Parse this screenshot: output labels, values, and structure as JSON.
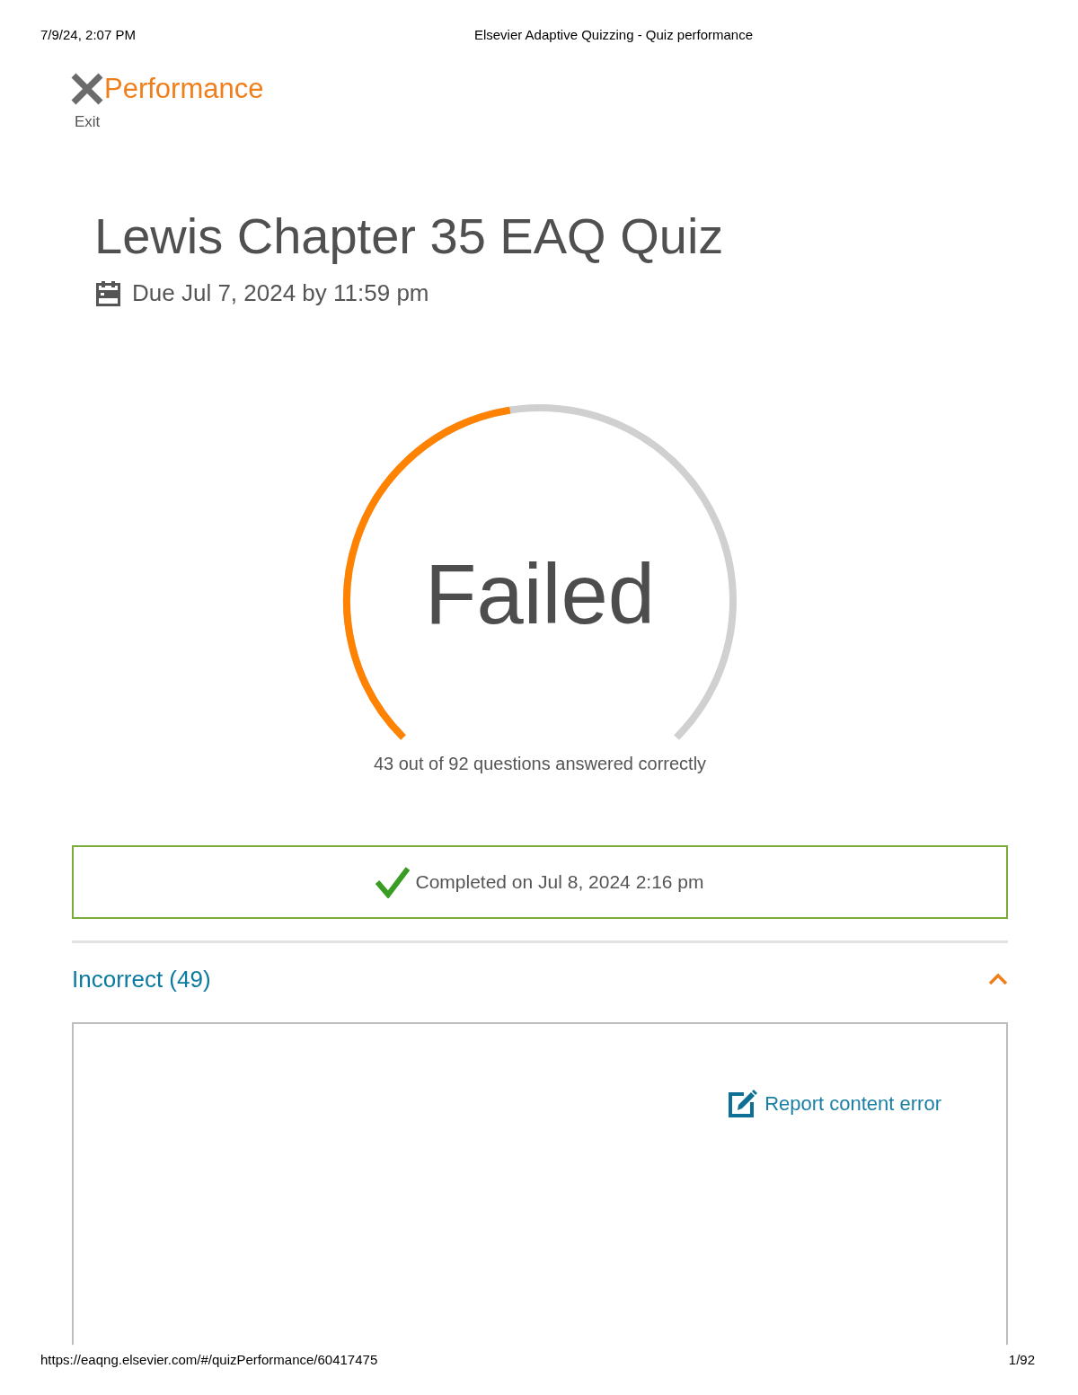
{
  "print_header": {
    "date": "7/9/24, 2:07 PM",
    "title": "Elsevier Adaptive Quizzing - Quiz performance"
  },
  "top_bar": {
    "heading": "Performance",
    "exit_label": "Exit"
  },
  "quiz": {
    "title": "Lewis Chapter 35 EAQ Quiz",
    "due": "Due Jul 7, 2024 by 11:59 pm"
  },
  "result": {
    "status": "Failed",
    "level": 0.467,
    "summary": "43 out of 92 questions answered correctly"
  },
  "completion": {
    "text": "Completed on Jul 8, 2024 2:16 pm"
  },
  "sections": [
    {
      "label": "Incorrect (49)",
      "expanded": true,
      "link": "Report content error"
    }
  ],
  "print_footer": {
    "url": "https://eaqng.elsevier.com/#/quizPerformance/60417475",
    "page": "1/92"
  }
}
